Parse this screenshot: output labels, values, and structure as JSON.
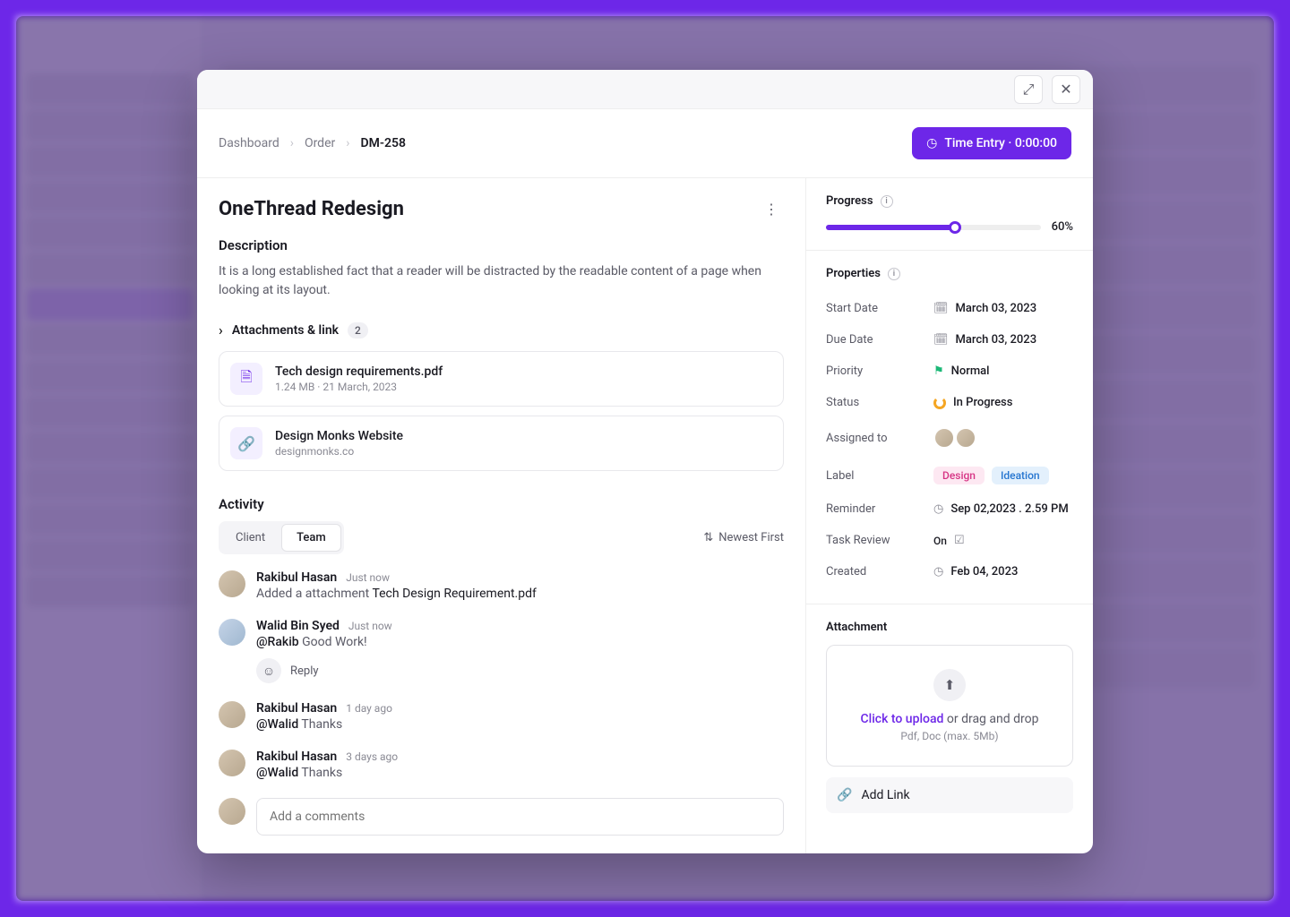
{
  "breadcrumb": {
    "root": "Dashboard",
    "mid": "Order",
    "current": "DM-258"
  },
  "time_btn": "Time Entry · 0:00:00",
  "title": "OneThread Redesign",
  "description": {
    "label": "Description",
    "text": "It is a long established fact that a reader will be distracted by the readable content of a page when looking at its layout."
  },
  "attachments": {
    "label": "Attachments & link",
    "count": "2",
    "items": [
      {
        "name": "Tech design requirements.pdf",
        "meta": "1.24 MB · 21 March, 2023",
        "type": "file"
      },
      {
        "name": "Design Monks Website",
        "meta": "designmonks.co",
        "type": "link"
      }
    ]
  },
  "activity": {
    "label": "Activity",
    "tabs": {
      "client": "Client",
      "team": "Team"
    },
    "sort": "Newest First",
    "items": [
      {
        "author": "Rakibul Hasan",
        "time": "Just now",
        "text_pre": "Added a attachment ",
        "text_strong": "Tech Design Requirement.pdf",
        "reply": false
      },
      {
        "author": "Walid Bin Syed",
        "time": "Just now",
        "mention": "@Rakib",
        "rest": " Good Work!",
        "reply": true
      },
      {
        "author": "Rakibul Hasan",
        "time": "1 day ago",
        "mention": "@Walid",
        "rest": " Thanks",
        "reply": false
      },
      {
        "author": "Rakibul Hasan",
        "time": "3 days ago",
        "mention": "@Walid",
        "rest": " Thanks",
        "reply": false
      }
    ],
    "reply_label": "Reply",
    "comment_placeholder": "Add a comments"
  },
  "progress": {
    "label": "Progress",
    "percent": 60,
    "display": "60%"
  },
  "properties": {
    "label": "Properties",
    "start_date": {
      "k": "Start Date",
      "v": "March 03, 2023"
    },
    "due_date": {
      "k": "Due Date",
      "v": "March 03, 2023"
    },
    "priority": {
      "k": "Priority",
      "v": "Normal"
    },
    "status": {
      "k": "Status",
      "v": "In Progress"
    },
    "assigned": {
      "k": "Assigned to"
    },
    "label_field": {
      "k": "Label",
      "v1": "Design",
      "v2": "Ideation"
    },
    "reminder": {
      "k": "Reminder",
      "v": "Sep 02,2023 . 2.59 PM"
    },
    "review": {
      "k": "Task Review",
      "v": "On"
    },
    "created": {
      "k": "Created",
      "v": "Feb 04, 2023"
    }
  },
  "attachment_panel": {
    "label": "Attachment",
    "upload_cta": "Click to upload",
    "upload_rest": " or drag and drop",
    "upload_hint": "Pdf, Doc  (max. 5Mb)",
    "add_link": "Add Link"
  }
}
